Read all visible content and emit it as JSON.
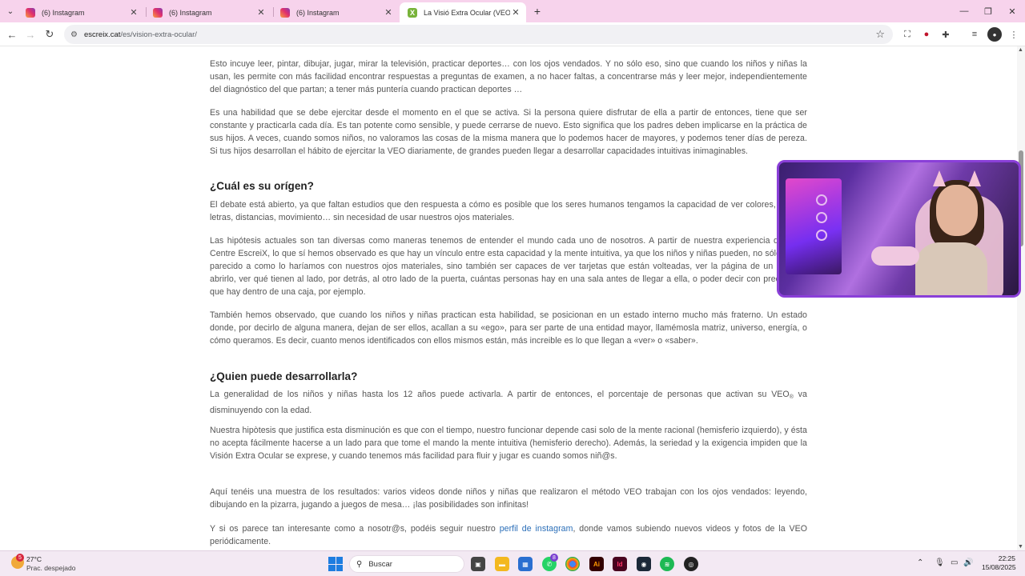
{
  "browser": {
    "tabs": [
      {
        "label": "(6) Instagram",
        "favicon": "instagram-icon",
        "active": false
      },
      {
        "label": "(6) Instagram",
        "favicon": "instagram-icon",
        "active": false
      },
      {
        "label": "(6) Instagram",
        "favicon": "instagram-icon",
        "active": false
      },
      {
        "label": "La Visió Extra Ocular (VEO) per",
        "favicon": "escreix-icon",
        "favicon_text": "X",
        "active": true
      }
    ],
    "url_host": "escreix.cat",
    "url_path": "/es/vision-extra-ocular/",
    "accent_color": "#f7d3ec"
  },
  "article": {
    "p1": "Esto incuye leer, pintar, dibujar, jugar, mirar la televisión, practicar deportes… con los ojos vendados. Y no sólo eso, sino que cuando los niños y niñas la usan, les permite con más facilidad encontrar respuestas a preguntas de examen, a no hacer faltas, a concentrarse más y leer mejor, independientemente del diagnóstico del que partan; a tener más puntería cuando practican deportes …",
    "p2": "Es una habilidad que se debe ejercitar desde el momento en el que se activa. Si la persona quiere disfrutar de ella a partir de entonces, tiene que ser constante y practicarla cada día. Es tan potente como sensible, y puede cerrarse de nuevo. Esto significa que los padres deben implicarse en la práctica de sus hijos. A veces, cuando somos niños, no valoramos las cosas de la misma manera que lo podemos hacer de mayores, y podemos tener días de pereza. Si tus hijos desarrollan el hábito de ejercitar la VEO diariamente, de grandes pueden llegar a desarrollar capacidades intuitivas inimaginables.",
    "h_origin": "¿Cuál es su orígen?",
    "p3": "El debate está abierto, ya que faltan estudios que den respuesta a cómo es posible que los seres humanos tengamos la capacidad de ver colores, formas, letras, distancias, movimiento… sin necesidad de usar nuestros ojos materiales.",
    "p4": "Las hipótesis actuales son tan diversas como maneras tenemos de entender el mundo cada uno de nosotros. A partir de nuestra experiencia desde el Centre EscreiX, lo que sí hemos observado es que hay un vínculo entre esta capacidad y la mente intuitiva, ya que los niños y niñas pueden, no sólo «ver», parecido a como lo haríamos con nuestros ojos materiales, sino también ser capaces de ver tarjetas que están volteadas, ver la página de un libro sin abrirlo, ver qué tienen al lado, por detrás, al otro lado de la puerta, cuántas personas hay en una sala antes de llegar a ella, o poder decir con precisión lo que hay dentro de una caja, por ejemplo.",
    "p5": "También hemos observado, que cuando los niños y niñas practican esta habilidad, se posicionan en un estado interno mucho más fraterno. Un estado donde, por decirlo de alguna manera, dejan de ser ellos, acallan a su «ego», para ser parte de una entidad mayor, llamémosla matriz, universo, energía, o cómo queramos. Es decir, cuanto menos identificados con ellos mismos están, más increible es lo que llegan a «ver» o «saber».",
    "h_who": "¿Quien puede desarrollarla?",
    "p6_a": "La generalidad de los niños y niñas hasta los 12 años puede activarla. A partir de entonces, el porcentaje de personas que activan su VEO",
    "p6_sup": "®",
    "p6_b": " va disminuyendo con la edad.",
    "p7": "Nuestra hipòtesis que justifica esta disminución es que con el tiempo, nuestro funcionar depende casi solo de la mente racional (hemisferio izquierdo), y  ésta no acepta fácilmente hacerse a un lado para que tome el mando la mente intuitiva (hemisferio derecho). Además, la seriedad y la exigencia impiden que la Visión Extra Ocular se exprese, y cuando tenemos más facilidad para fluir y jugar es cuando somos niñ@s.",
    "p8": "Aquí tenéis una muestra de los resultados: varios videos donde niños y niñas que realizaron el método VEO trabajan con los ojos vendados: leyendo, dibujando en la pizarra, jugando a juegos de mesa… ¡las posibilidades son infinitas!",
    "p9_a": "Y si os parece tan interesante como a nosotr@s, podéis seguir nuestro ",
    "p9_link": "perfil de instagram",
    "p9_b": ", donde vamos subiendo nuevos videos y fotos de la VEO periódicamente."
  },
  "taskbar": {
    "weather_temp": "27°C",
    "weather_desc": "Prac. despejado",
    "weather_badge": "5",
    "search_placeholder": "Buscar",
    "whatsapp_badge": "8",
    "time": "22:25",
    "date": "15/08/2025"
  }
}
